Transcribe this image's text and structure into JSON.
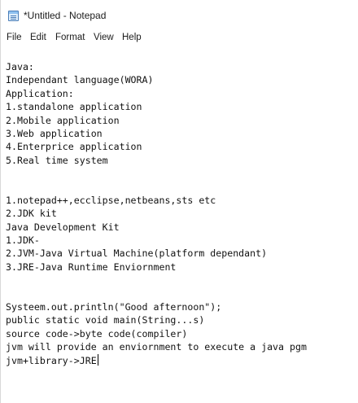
{
  "window": {
    "title": "*Untitled - Notepad",
    "icon": "notepad-icon"
  },
  "menu": {
    "file": "File",
    "edit": "Edit",
    "format": "Format",
    "view": "View",
    "help": "Help"
  },
  "editor": {
    "lines": [
      "Java:",
      "Independant language(WORA)",
      "Application:",
      "1.standalone application",
      "2.Mobile application",
      "3.Web application",
      "4.Enterprice application",
      "5.Real time system",
      "",
      "",
      "1.notepad++,ecclipse,netbeans,sts etc",
      "2.JDK kit",
      "Java Development Kit",
      "1.JDK-",
      "2.JVM-Java Virtual Machine(platform dependant)",
      "3.JRE-Java Runtime Enviornment",
      "",
      "",
      "Systeem.out.println(\"Good afternoon\");",
      "public static void main(String...s)",
      "source code->byte code(compiler)",
      "jvm will provide an enviornment to execute a java pgm",
      "jvm+library->JRE"
    ]
  }
}
